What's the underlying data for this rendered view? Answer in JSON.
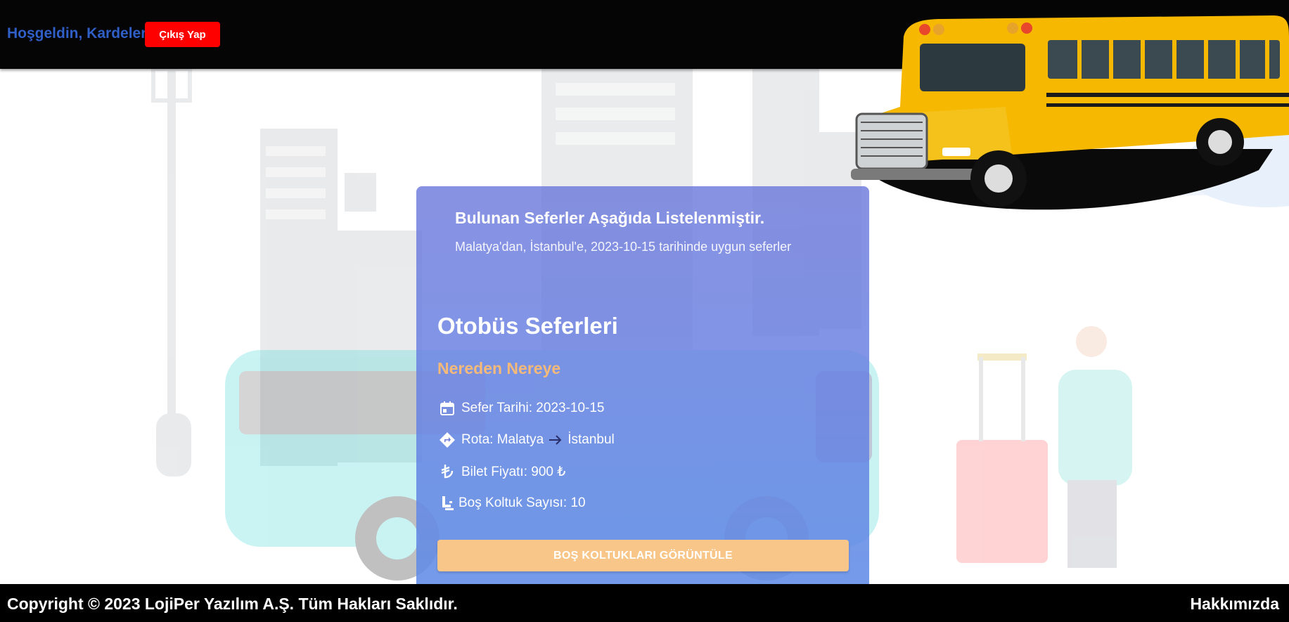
{
  "header": {
    "welcome_text": "Hoşgeldin, Kardelen",
    "logout_label": "Çıkış Yap"
  },
  "results": {
    "title": "Bulunan Seferler Aşağıda Listelenmiştir.",
    "subtitle": "Malatya'dan, İstanbul'e, 2023-10-15 tarihinde uygun seferler"
  },
  "trip": {
    "section_title": "Otobüs Seferleri",
    "route_heading": "Nereden Nereye",
    "date_text": "Sefer Tarihi: 2023-10-15",
    "route_prefix": "Rota: Malatya",
    "route_destination": "İstanbul",
    "price_text": "Bilet Fiyatı: 900 ₺",
    "seats_text": "Boş Koltuk Sayısı: 10",
    "seats_button_label": "BOŞ KOLTUKLARI GÖRÜNTÜLE",
    "icons": [
      "calendar-icon",
      "directions-icon",
      "lira-icon",
      "seat-icon",
      "arrow-right-icon"
    ]
  },
  "footer": {
    "copyright": "Copyright © 2023 LojiPer Yazılım A.Ş. Tüm Hakları Saklıdır.",
    "about_label": "Hakkımızda"
  },
  "colors": {
    "header_bg": "#050505",
    "logout_bg": "#ff0000",
    "welcome_text": "#2f5fc7",
    "card_bg": "#6e7adc",
    "route_heading": "#f5b97a",
    "button_bg": "#f8c688",
    "footer_bg": "#000000"
  }
}
